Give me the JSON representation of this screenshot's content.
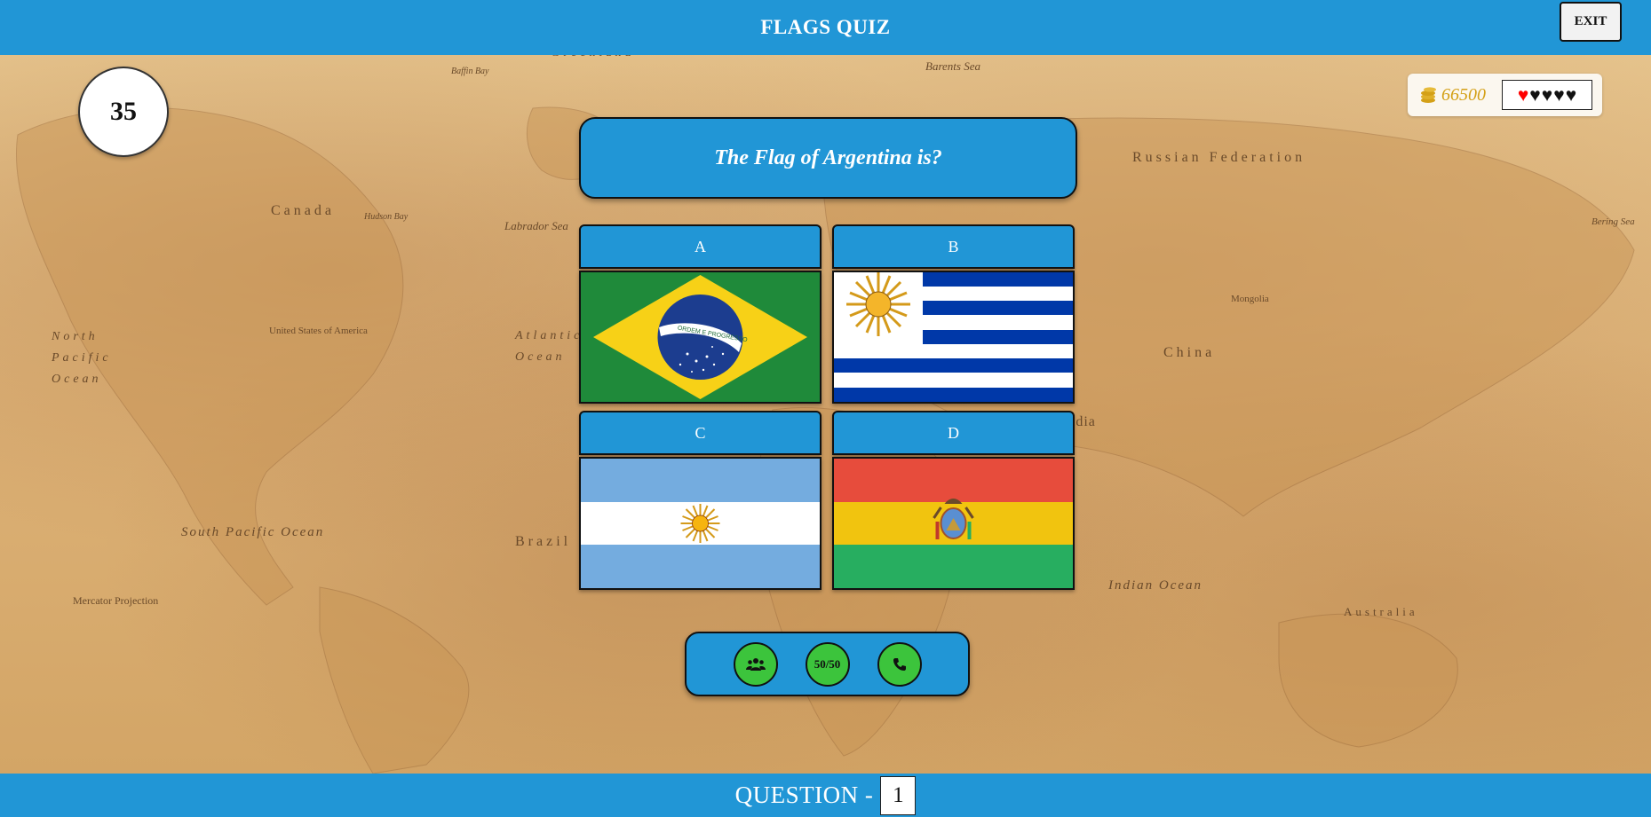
{
  "header": {
    "title": "FLAGS QUIZ",
    "exit_label": "EXIT"
  },
  "timer": {
    "value": "35"
  },
  "status": {
    "coins": "66500",
    "lives_total": 5,
    "lives_remaining": 1,
    "life_color": "#ff0000",
    "lost_life_color": "#111111"
  },
  "question": {
    "text": "The Flag of  Argentina is?"
  },
  "options": [
    {
      "letter": "A",
      "flag": "brazil-flag",
      "flag_text": "ORDEM E PROGRESSO"
    },
    {
      "letter": "B",
      "flag": "uruguay-flag"
    },
    {
      "letter": "C",
      "flag": "argentina-flag"
    },
    {
      "letter": "D",
      "flag": "bolivia-flag"
    }
  ],
  "lifelines": [
    {
      "name": "audience-icon"
    },
    {
      "label": "50/50"
    },
    {
      "name": "phone-icon"
    }
  ],
  "footer": {
    "question_label": "QUESTION -",
    "question_number": "1"
  },
  "map_labels": [
    "Greenland",
    "Barents Sea",
    "Russian Federation",
    "Canada",
    "Labrador Sea",
    "North Pacific Ocean",
    "United States of America",
    "Atlantic Ocean",
    "China",
    "India",
    "Mongolia",
    "South Pacific Ocean",
    "Brazil",
    "Indian Ocean",
    "Australia",
    "Mercator Projection",
    "Bering Sea",
    "Hudson Bay",
    "Baffin Bay"
  ],
  "colors": {
    "accent": "#2196d6",
    "lifeline": "#3cc43c",
    "coin": "#d4a017"
  }
}
